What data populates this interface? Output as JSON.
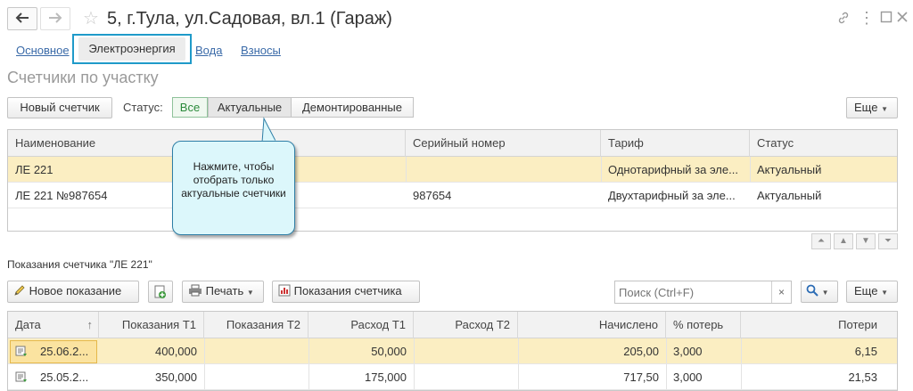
{
  "window": {
    "title": "5, г.Тула, ул.Садовая, вл.1 (Гараж)",
    "back_icon": "arrow-left",
    "forward_icon": "arrow-right",
    "favorite_icon": "star",
    "link_icon": "link",
    "menu_icon": "kebab",
    "maximize_icon": "square",
    "close_icon": "x"
  },
  "tabs": {
    "main": "Основное",
    "electricity": "Электроэнергия",
    "water": "Вода",
    "fees": "Взносы"
  },
  "meters_section": {
    "title": "Счетчики по участку",
    "new_meter": "Новый счетчик",
    "status_label": "Статус:",
    "status_all": "Все",
    "status_actual": "Актуальные",
    "status_dismantled": "Демонтированные",
    "more": "Еще",
    "columns": {
      "name": "Наименование",
      "serial": "Серийный номер",
      "tariff": "Тариф",
      "status": "Статус"
    },
    "rows": [
      {
        "name": "ЛЕ 221",
        "serial": "",
        "tariff": "Однотарифный за эле...",
        "status": "Актуальный"
      },
      {
        "name": "ЛЕ 221 №987654",
        "serial": "987654",
        "tariff": "Двухтарифный за эле...",
        "status": "Актуальный"
      }
    ],
    "tooltip": "Нажмите, чтобы отобрать только актуальные счетчики"
  },
  "readings_section": {
    "title": "Показания счетчика \"ЛЕ 221\"",
    "new_reading": "Новое показание",
    "print": "Печать",
    "meter_readings": "Показания счетчика",
    "search_placeholder": "Поиск (Ctrl+F)",
    "more": "Еще",
    "columns": {
      "date": "Дата",
      "t1": "Показания Т1",
      "t2": "Показания Т2",
      "exp1": "Расход Т1",
      "exp2": "Расход Т2",
      "charged": "Начислено",
      "loss_pct": "% потерь",
      "losses": "Потери"
    },
    "rows": [
      {
        "date": "25.06.2...",
        "t1": "400,000",
        "t2": "",
        "exp1": "50,000",
        "exp2": "",
        "charged": "205,00",
        "loss_pct": "3,000",
        "losses": "6,15"
      },
      {
        "date": "25.05.2...",
        "t1": "350,000",
        "t2": "",
        "exp1": "175,000",
        "exp2": "",
        "charged": "717,50",
        "loss_pct": "3,000",
        "losses": "21,53"
      }
    ]
  },
  "colors": {
    "accent_border": "#1f9ac9",
    "link": "#3a6aa8",
    "selected_row": "#fbeec2",
    "tooltip_bg": "#dcf7fb",
    "active_segment_text": "#2a8a3a"
  }
}
